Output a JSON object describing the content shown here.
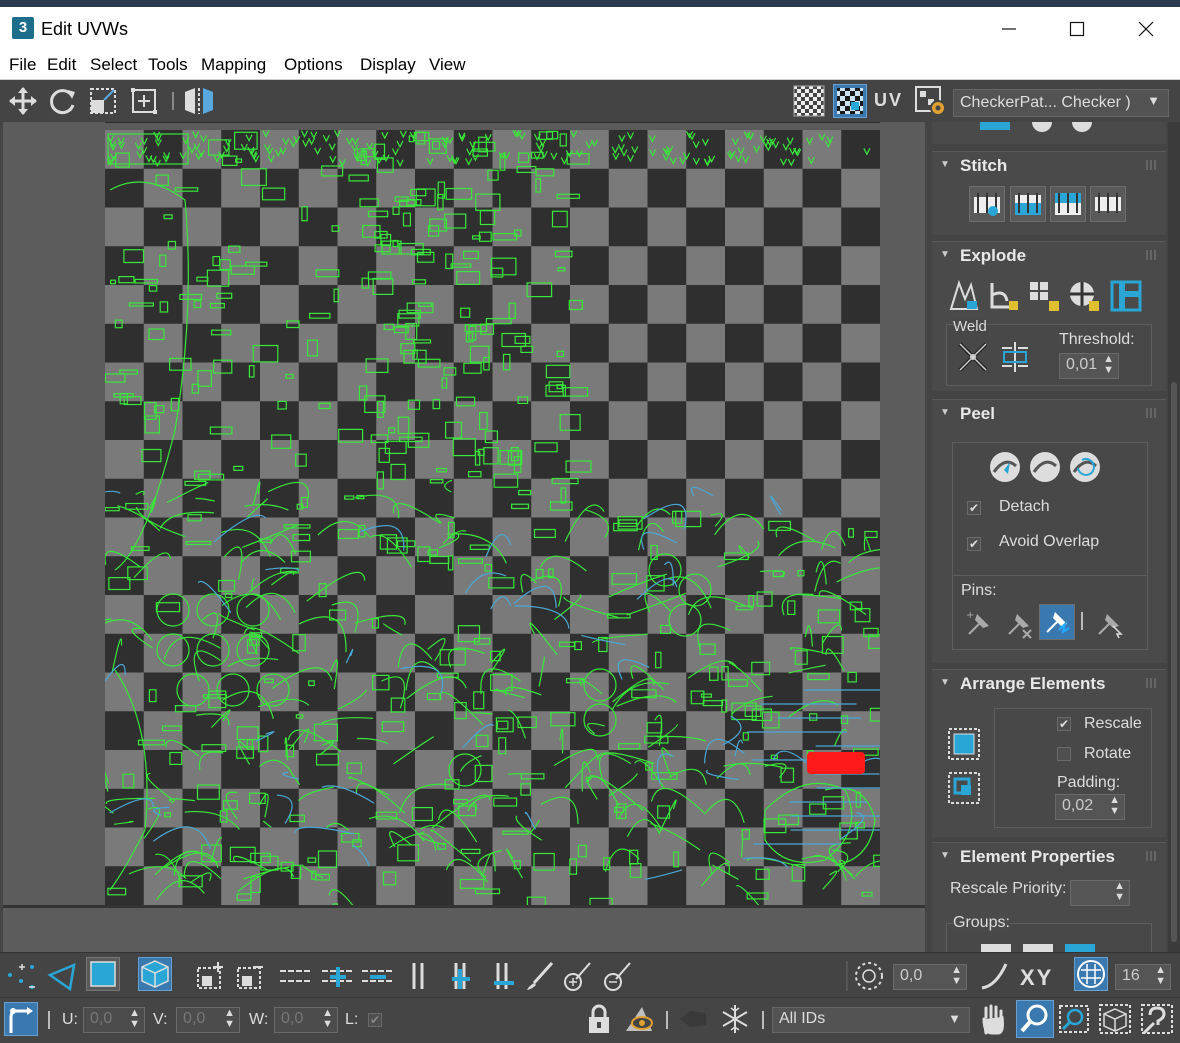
{
  "window": {
    "app_icon": "3",
    "title": "Edit UVWs",
    "controls": [
      "minimize-icon",
      "maximize-icon",
      "close-icon"
    ]
  },
  "menu": [
    "File",
    "Edit",
    "Select",
    "Tools",
    "Mapping",
    "Options",
    "Display",
    "View"
  ],
  "toolbar": {
    "uv_label": "UV",
    "checker_dropdown": "CheckerPat... Checker )"
  },
  "panels": {
    "stitch": {
      "title": "Stitch"
    },
    "explode": {
      "title": "Explode",
      "weld_label": "Weld",
      "threshold_label": "Threshold:",
      "threshold_value": "0,01"
    },
    "peel": {
      "title": "Peel",
      "detach_label": "Detach",
      "detach_checked": true,
      "avoid_overlap_label": "Avoid Overlap",
      "avoid_overlap_checked": true,
      "pins_label": "Pins:"
    },
    "arrange": {
      "title": "Arrange Elements",
      "rescale_label": "Rescale",
      "rescale_checked": true,
      "rotate_label": "Rotate",
      "rotate_checked": false,
      "padding_label": "Padding:",
      "padding_value": "0,02"
    },
    "element_props": {
      "title": "Element Properties",
      "rescale_priority_label": "Rescale Priority:",
      "rescale_priority_value": "",
      "groups_label": "Groups:"
    }
  },
  "bottom": {
    "soft_value": "0,0",
    "xy_label": "XY",
    "grid_value": "16",
    "u_label": "U:",
    "u_value": "0,0",
    "v_label": "V:",
    "v_value": "0,0",
    "w_label": "W:",
    "w_value": "0,0",
    "l_label": "L:",
    "ids_dropdown": "All IDs"
  },
  "colors": {
    "uv_wire": "#39e83a",
    "uv_wire_blue": "#4aa8d6",
    "checker_light": "#7a7a7a",
    "checker_dark": "#2f2f2f",
    "selected_red": "#ff1a1a",
    "accent": "#3a79b0"
  }
}
